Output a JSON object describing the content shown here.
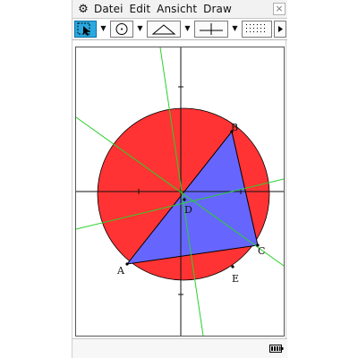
{
  "menubar": {
    "items": [
      "Datei",
      "Edit",
      "Ansicht",
      "Draw"
    ],
    "close_label": "×"
  },
  "geometry": {
    "points": [
      {
        "id": "A",
        "label": "A"
      },
      {
        "id": "B",
        "label": "B"
      },
      {
        "id": "C",
        "label": "C"
      },
      {
        "id": "D",
        "label": "D"
      },
      {
        "id": "E",
        "label": "E"
      }
    ]
  },
  "colors": {
    "circle_fill": "#ff3333",
    "triangle_fill": "#6666ff",
    "lines": "#2bd12b",
    "axes": "#111111",
    "toolbar_selected": "#2aa9e0"
  },
  "icons": {
    "settings": "gear-icon",
    "select_tool": "select-arrow-icon",
    "circle_tool": "circle-icon",
    "triangle_tool": "triangle-icon",
    "axes_tool": "axes-icon",
    "grid_tool": "grid-icon",
    "more": "play-right-icon",
    "battery": "battery-icon"
  }
}
